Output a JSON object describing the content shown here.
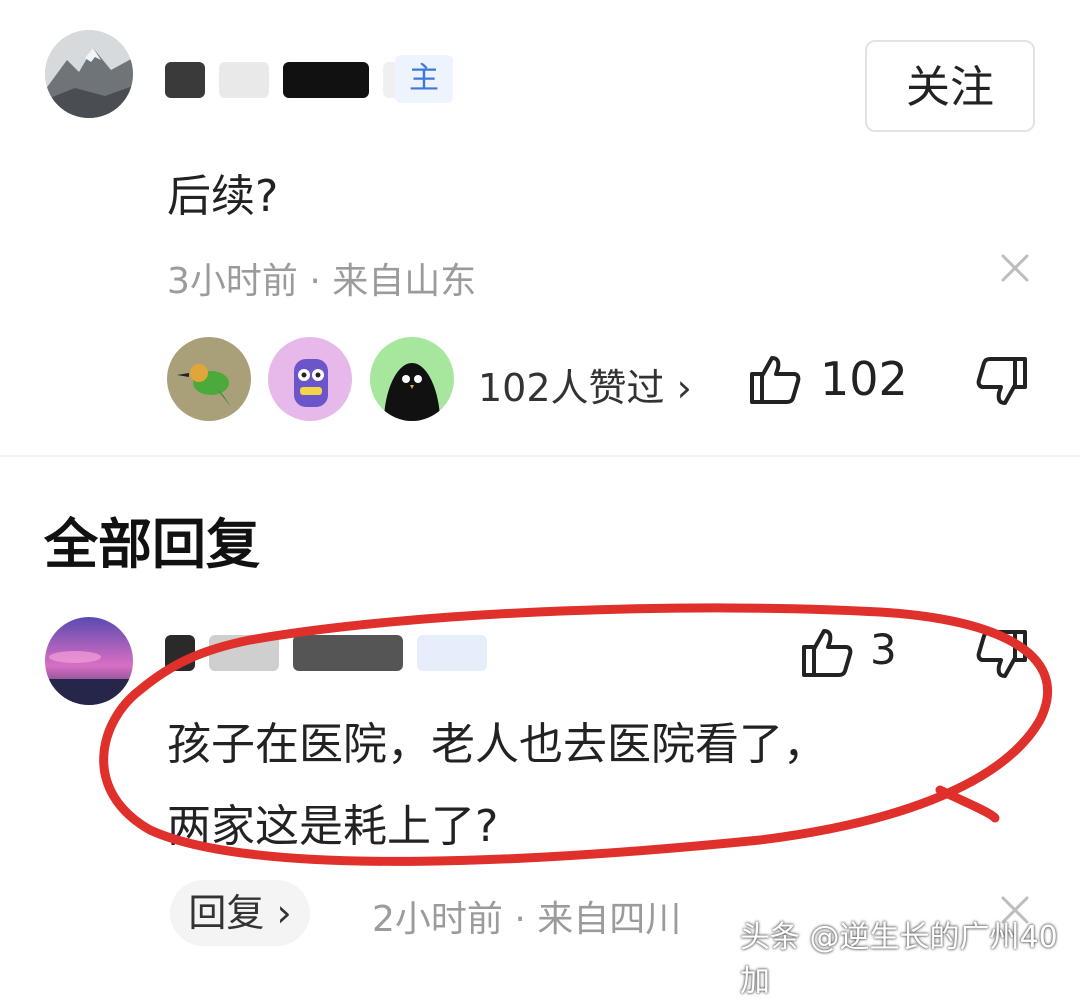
{
  "comment": {
    "author_tag": "主",
    "follow_label": "关注",
    "text": "后续?",
    "meta": "3小时前 · 来自山东",
    "likes_summary": "102人赞过 ›",
    "like_count": "102"
  },
  "section_title": "全部回复",
  "reply": {
    "like_count": "3",
    "text_line1": "孩子在医院，老人也去医院看了，",
    "text_line2": "两家这是耗上了?",
    "reply_label": "回复 ›",
    "meta": "2小时前 · 来自四川"
  },
  "watermark": "头条 @逆生长的广州40加",
  "icons": {
    "close": "close-icon",
    "thumb_up": "thumb-up-icon",
    "thumb_down": "thumb-down-icon"
  },
  "colors": {
    "accent_blue": "#3f78d6",
    "annotation_red": "#e0302b",
    "meta_gray": "#9b9b9b"
  }
}
